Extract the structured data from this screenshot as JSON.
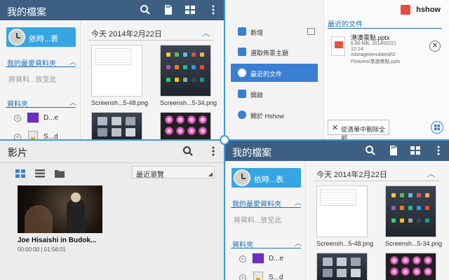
{
  "file_manager": {
    "title": "我的檔案",
    "recent_label": "依時...表",
    "favorites_label": "我的最愛資料夾",
    "favorites_placeholder": "將資料...放至此",
    "folders_label": "資料夾",
    "folder_items": [
      {
        "label": "D...e",
        "type": "device"
      },
      {
        "label": "S...d",
        "type": "sdcard"
      }
    ],
    "date_heading": "今天  2014年2月22日",
    "thumbnails": [
      {
        "caption": "Screensh...5-48.png",
        "kind": "doc"
      },
      {
        "caption": "Screensh...5-34.png",
        "kind": "home"
      },
      {
        "caption": "",
        "kind": "home"
      },
      {
        "caption": "",
        "kind": "gallery"
      }
    ],
    "icons": [
      "search-icon",
      "sd-card-icon",
      "grid-view-icon",
      "more-icon"
    ]
  },
  "file_manager_2": {
    "title": "我的檔案",
    "recent_label": "依時...表",
    "favorites_label": "我的最愛資料夾",
    "favorites_placeholder": "將資料...放至此",
    "folders_label": "資料夾",
    "folder_items": [
      {
        "label": "D...e"
      },
      {
        "label": "S...d"
      }
    ],
    "date_heading": "今天  2014年2月22日",
    "captions": [
      "Screensh...5-48.png",
      "Screensh...5-34.png"
    ]
  },
  "video": {
    "title": "影片",
    "sort_value": "最近瀏覽",
    "items": [
      {
        "name": "Joe Hisaishi in Budok...",
        "time": "00:00:00 | 01:56:01"
      }
    ]
  },
  "hshow": {
    "brand": "hshow",
    "menu": [
      {
        "label": "新增",
        "icon": "new-icon",
        "color": "#3a7fd2"
      },
      {
        "label": "選取佈景主題",
        "icon": "theme-icon",
        "color": "#3a7fd2"
      },
      {
        "label": "最近的文件",
        "icon": "clock-icon",
        "color": "#ffffff"
      },
      {
        "label": "開啟",
        "icon": "folder-icon",
        "color": "#3a7fd2"
      },
      {
        "label": "關於 Hshow",
        "icon": "info-icon",
        "color": "#3a7fd2"
      }
    ],
    "active_index": 2,
    "recent_title": "最近的文件",
    "recent_file": {
      "name": "港澳景點.pptx",
      "meta1": "6.80 MB, 2014/02/21",
      "meta2": "12:14",
      "meta3": "/storage/emulated/0/",
      "meta4": "Pictures/港澳景點.pptx"
    },
    "clear_label": "從清單中刪除全部"
  },
  "colors": {
    "accent": "#3d9ad8",
    "header": "#3d5f82",
    "button": "#36a6e2",
    "hshow_active": "#3a7fd2"
  }
}
